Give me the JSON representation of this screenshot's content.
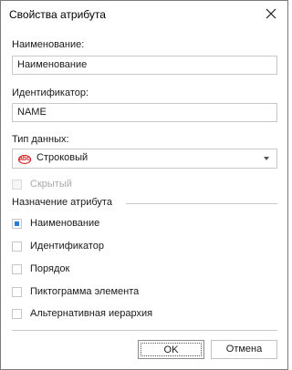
{
  "window": {
    "title": "Свойства атрибута"
  },
  "fields": {
    "name_label": "Наименование:",
    "name_value": "Наименование",
    "id_label": "Идентификатор:",
    "id_value": "NAME",
    "type_label": "Тип данных:",
    "type_value": "Строковый",
    "type_icon_text": "abc"
  },
  "hidden_checkbox": {
    "label": "Скрытый",
    "checked": false,
    "enabled": false
  },
  "purpose": {
    "title": "Назначение атрибута",
    "items": [
      {
        "label": "Наименование",
        "checked": true
      },
      {
        "label": "Идентификатор",
        "checked": false
      },
      {
        "label": "Порядок",
        "checked": false
      },
      {
        "label": "Пиктограмма элемента",
        "checked": false
      },
      {
        "label": "Альтернативная иерархия",
        "checked": false
      }
    ]
  },
  "buttons": {
    "ok": "OK",
    "cancel": "Отмена"
  },
  "colors": {
    "accent": "#2b7cd3",
    "icon_red": "#d4262b"
  }
}
